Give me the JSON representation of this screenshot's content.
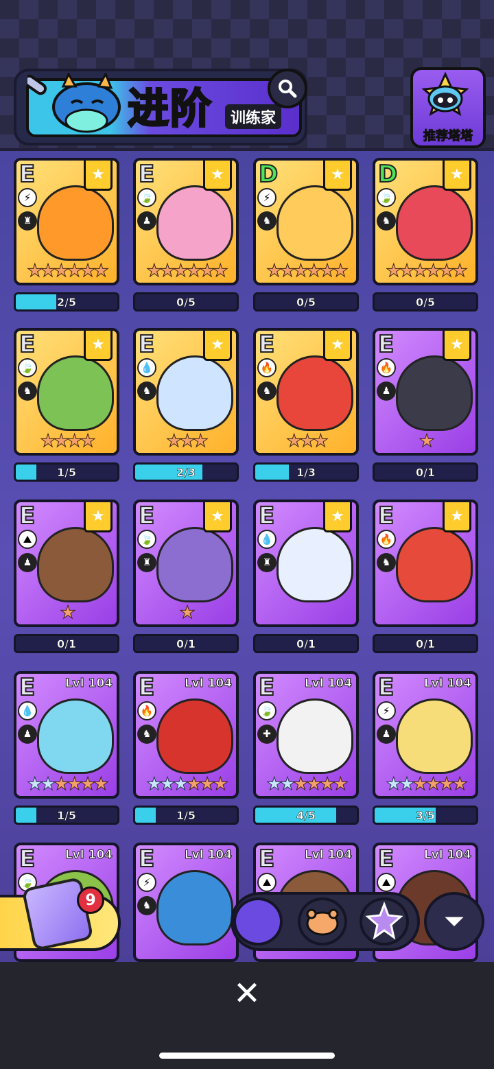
{
  "header": {
    "title": "进阶",
    "subtitle": "训练家",
    "recommend_label": "推荐塔塔"
  },
  "icons": {
    "search": "search-icon",
    "close": "close-icon",
    "filter": "filter-icon",
    "favorite": "star-ribbon-icon"
  },
  "colors": {
    "bar_fill": "#3ad0ec",
    "gold_card": "#ffb12a",
    "purple_card": "#9a3fe6"
  },
  "rows": [
    [
      {
        "grade": "E",
        "theme": "gold",
        "color": "#ff9a2a",
        "element": "⚡",
        "role": "♜",
        "stars": 6,
        "silver": 0,
        "progress": "2/5",
        "fill": 0.4,
        "level": ""
      },
      {
        "grade": "E",
        "theme": "gold",
        "color": "#f5a3c8",
        "element": "🍃",
        "role": "♟",
        "stars": 6,
        "silver": 0,
        "progress": "0/5",
        "fill": 0,
        "level": ""
      },
      {
        "grade": "D",
        "theme": "gold",
        "color": "#ffcb5a",
        "element": "⚡",
        "role": "♞",
        "stars": 6,
        "silver": 0,
        "progress": "0/5",
        "fill": 0,
        "level": ""
      },
      {
        "grade": "D",
        "theme": "gold",
        "color": "#e84a5a",
        "element": "🍃",
        "role": "♞",
        "stars": 6,
        "silver": 0,
        "progress": "0/5",
        "fill": 0,
        "level": ""
      }
    ],
    [
      {
        "grade": "E",
        "theme": "gold",
        "color": "#7cc254",
        "element": "🍃",
        "role": "♞",
        "stars": 4,
        "silver": 0,
        "progress": "1/5",
        "fill": 0.2,
        "level": ""
      },
      {
        "grade": "E",
        "theme": "gold",
        "color": "#cfe4ff",
        "element": "💧",
        "role": "♞",
        "stars": 3,
        "silver": 0,
        "progress": "2/3",
        "fill": 0.66,
        "level": ""
      },
      {
        "grade": "E",
        "theme": "gold",
        "color": "#e8463a",
        "element": "🔥",
        "role": "♞",
        "stars": 3,
        "silver": 0,
        "progress": "1/3",
        "fill": 0.33,
        "level": ""
      },
      {
        "grade": "E",
        "theme": "purple",
        "color": "#3b3b4a",
        "element": "🔥",
        "role": "♟",
        "stars": 1,
        "silver": 0,
        "progress": "0/1",
        "fill": 0,
        "level": ""
      }
    ],
    [
      {
        "grade": "E",
        "theme": "purple",
        "color": "#8a5a3a",
        "element": "⛰",
        "role": "♟",
        "stars": 1,
        "silver": 0,
        "progress": "0/1",
        "fill": 0,
        "level": ""
      },
      {
        "grade": "E",
        "theme": "purple",
        "color": "#8c6ed0",
        "element": "🍃",
        "role": "♜",
        "stars": 1,
        "silver": 0,
        "progress": "0/1",
        "fill": 0,
        "level": ""
      },
      {
        "grade": "E",
        "theme": "purple",
        "color": "#e8f0ff",
        "element": "💧",
        "role": "♜",
        "stars": 0,
        "silver": 0,
        "progress": "0/1",
        "fill": 0,
        "level": ""
      },
      {
        "grade": "E",
        "theme": "purple",
        "color": "#e64a3a",
        "element": "🔥",
        "role": "♞",
        "stars": 0,
        "silver": 0,
        "progress": "0/1",
        "fill": 0,
        "level": ""
      }
    ],
    [
      {
        "grade": "E",
        "theme": "purple",
        "color": "#7fd7f0",
        "element": "💧",
        "role": "♟",
        "stars": 4,
        "silver": 2,
        "progress": "1/5",
        "fill": 0.2,
        "level": "Lvl 104"
      },
      {
        "grade": "E",
        "theme": "purple",
        "color": "#d8342e",
        "element": "🔥",
        "role": "♞",
        "stars": 3,
        "silver": 3,
        "progress": "1/5",
        "fill": 0.2,
        "level": "Lvl 104"
      },
      {
        "grade": "E",
        "theme": "purple",
        "color": "#f2f2f2",
        "element": "🍃",
        "role": "✚",
        "stars": 4,
        "silver": 2,
        "progress": "4/5",
        "fill": 0.8,
        "level": "Lvl 104"
      },
      {
        "grade": "E",
        "theme": "purple",
        "color": "#f7dc7a",
        "element": "⚡",
        "role": "♟",
        "stars": 4,
        "silver": 2,
        "progress": "3/5",
        "fill": 0.6,
        "level": "Lvl 104"
      }
    ],
    [
      {
        "grade": "E",
        "theme": "purple",
        "color": "#8bc34a",
        "element": "🍃",
        "role": "",
        "stars": 0,
        "silver": 0,
        "progress": "",
        "fill": 0,
        "level": "Lvl 104"
      },
      {
        "grade": "E",
        "theme": "purple",
        "color": "#3a8dd8",
        "element": "⚡",
        "role": "♞",
        "stars": 0,
        "silver": 0,
        "progress": "",
        "fill": 0,
        "level": "Lvl 104"
      },
      {
        "grade": "E",
        "theme": "purple",
        "color": "#8a5a3a",
        "element": "⛰",
        "role": "",
        "stars": 0,
        "silver": 0,
        "progress": "",
        "fill": 0,
        "level": "Lvl 104"
      },
      {
        "grade": "E",
        "theme": "purple",
        "color": "#6b3a2a",
        "element": "⛰",
        "role": "",
        "stars": 0,
        "silver": 0,
        "progress": "",
        "fill": 0,
        "level": "Lvl 104"
      }
    ]
  ],
  "dock": {
    "chest_badge": "9"
  }
}
